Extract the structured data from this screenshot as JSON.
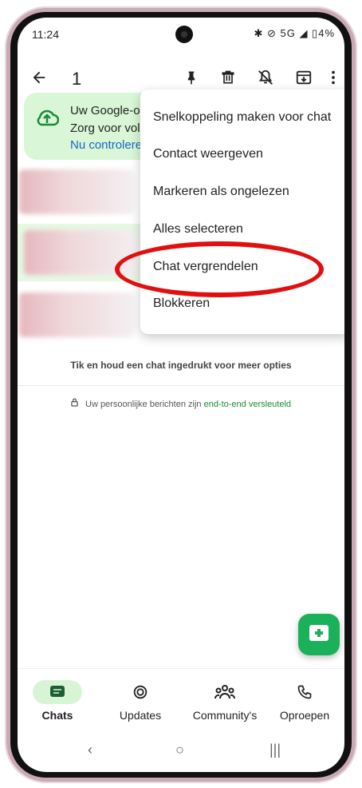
{
  "status": {
    "time": "11:24",
    "icons": "✱ ⊘ 5G ◢ ▯4%"
  },
  "appbar": {
    "back_icon": "arrow-left",
    "selected_count": "1",
    "pin_icon": "pin",
    "delete_icon": "trash",
    "mute_icon": "bell-off",
    "archive_icon": "archive",
    "more_icon": "more-vert"
  },
  "banner": {
    "line1": "Uw Google-op",
    "line2": "Zorg voor vol",
    "link": "Nu controlere"
  },
  "menu": {
    "items": [
      "Snelkoppeling maken voor chat",
      "Contact weergeven",
      "Markeren als ongelezen",
      "Alles selecteren",
      "Chat vergrendelen",
      "Blokkeren"
    ]
  },
  "hint": "Tik en houd een chat ingedrukt voor meer opties",
  "secure": {
    "prefix": "Uw persoonlijke berichten zijn ",
    "link": "end-to-end versleuteld"
  },
  "nav": {
    "items": [
      {
        "label": "Chats",
        "icon": "chat-icon"
      },
      {
        "label": "Updates",
        "icon": "updates-icon"
      },
      {
        "label": "Community's",
        "icon": "community-icon"
      },
      {
        "label": "Oproepen",
        "icon": "phone-icon"
      }
    ]
  },
  "colors": {
    "accent": "#1bb05a",
    "highlight": "#e7f8e3",
    "annotation": "#e11010",
    "link": "#1a64c8"
  }
}
